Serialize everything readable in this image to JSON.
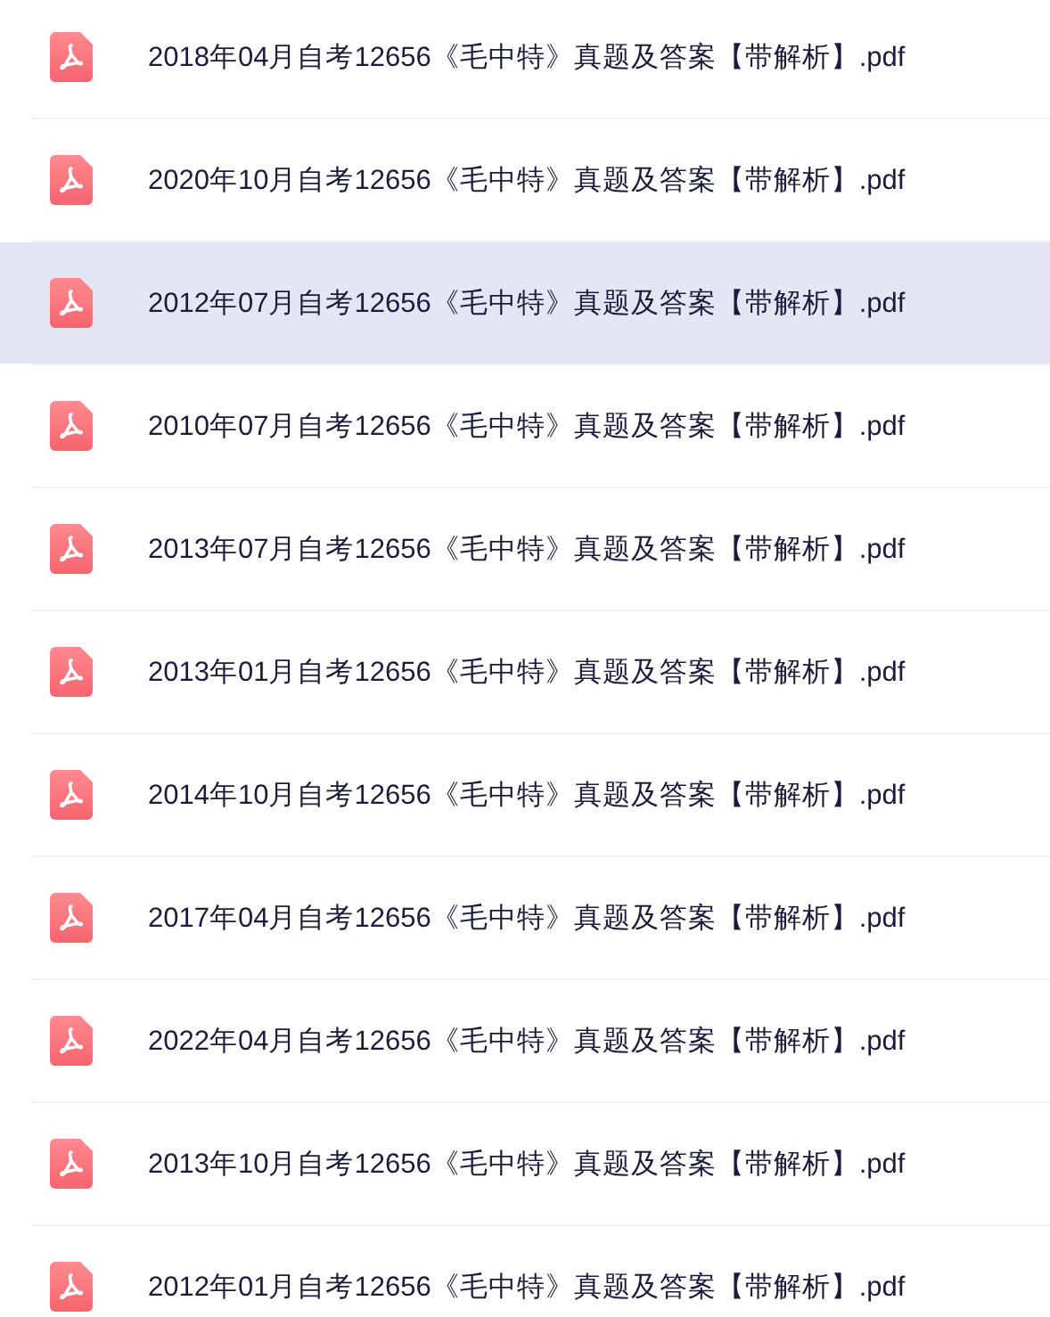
{
  "files": [
    {
      "name": "2018年04月自考12656《毛中特》真题及答案【带解析】.pdf",
      "selected": false
    },
    {
      "name": "2020年10月自考12656《毛中特》真题及答案【带解析】.pdf",
      "selected": false
    },
    {
      "name": "2012年07月自考12656《毛中特》真题及答案【带解析】.pdf",
      "selected": true
    },
    {
      "name": "2010年07月自考12656《毛中特》真题及答案【带解析】.pdf",
      "selected": false
    },
    {
      "name": "2013年07月自考12656《毛中特》真题及答案【带解析】.pdf",
      "selected": false
    },
    {
      "name": "2013年01月自考12656《毛中特》真题及答案【带解析】.pdf",
      "selected": false
    },
    {
      "name": "2014年10月自考12656《毛中特》真题及答案【带解析】.pdf",
      "selected": false
    },
    {
      "name": "2017年04月自考12656《毛中特》真题及答案【带解析】.pdf",
      "selected": false
    },
    {
      "name": "2022年04月自考12656《毛中特》真题及答案【带解析】.pdf",
      "selected": false
    },
    {
      "name": "2013年10月自考12656《毛中特》真题及答案【带解析】.pdf",
      "selected": false
    },
    {
      "name": "2012年01月自考12656《毛中特》真题及答案【带解析】.pdf",
      "selected": false
    }
  ]
}
